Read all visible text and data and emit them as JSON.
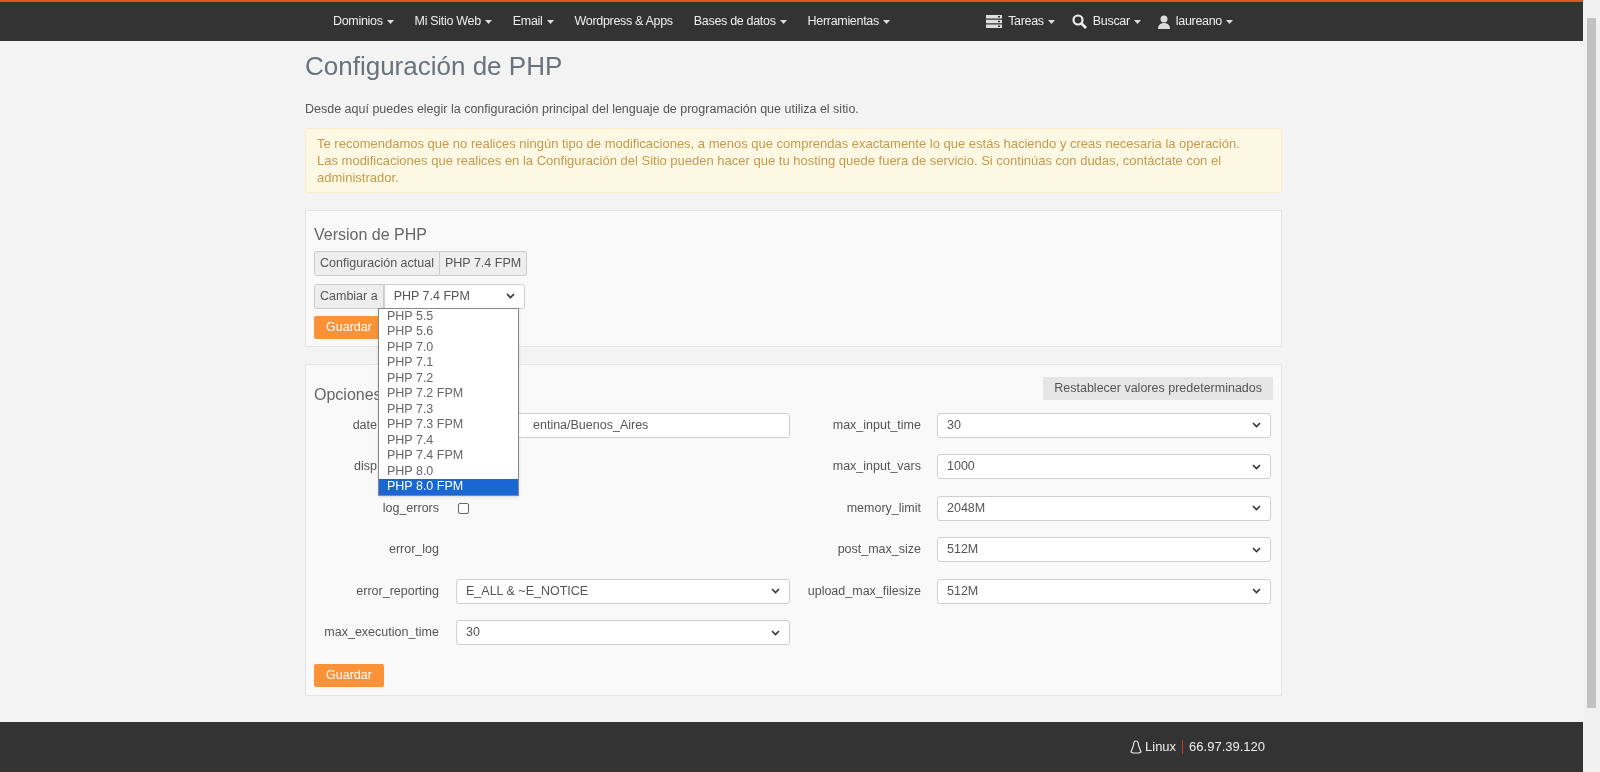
{
  "nav": {
    "items": [
      {
        "label": "Dominios",
        "dropdown": true
      },
      {
        "label": "Mi Sitio Web",
        "dropdown": true
      },
      {
        "label": "Email",
        "dropdown": true
      },
      {
        "label": "Wordpress & Apps",
        "dropdown": false
      },
      {
        "label": "Bases de datos",
        "dropdown": true
      },
      {
        "label": "Herramientas",
        "dropdown": true
      }
    ],
    "right": [
      {
        "kind": "tasks",
        "label": "Tareas"
      },
      {
        "kind": "search",
        "label": "Buscar"
      },
      {
        "kind": "user",
        "label": "laureano"
      }
    ]
  },
  "title": "Configuración de PHP",
  "description": "Desde aquí puedes elegir la configuración principal del lenguaje de programación que utiliza el sitio.",
  "warning": [
    "Te recomendamos que no realices ningún tipo de modificaciones, a menos que comprendas exactamente lo que estás haciendo y creas necesaria la operación.",
    "Las modificaciones que realices en la Configuración del Sitio pueden hacer que tu hosting quede fuera de servicio. Si continúas con dudas, contáctate con el administrador."
  ],
  "version": {
    "title": "Version de PHP",
    "current_label": "Configuración actual",
    "current_value": "PHP 7.4 FPM",
    "change_label": "Cambiar a",
    "select_value": "PHP 7.4 FPM",
    "save_button": "Guardar",
    "dropdown": [
      {
        "label": "PHP 5.5",
        "selected": false
      },
      {
        "label": "PHP 5.6",
        "selected": false
      },
      {
        "label": "PHP 7.0",
        "selected": false
      },
      {
        "label": "PHP 7.1",
        "selected": false
      },
      {
        "label": "PHP 7.2",
        "selected": false
      },
      {
        "label": "PHP 7.2 FPM",
        "selected": false
      },
      {
        "label": "PHP 7.3",
        "selected": false
      },
      {
        "label": "PHP 7.3 FPM",
        "selected": false
      },
      {
        "label": "PHP 7.4",
        "selected": false
      },
      {
        "label": "PHP 7.4 FPM",
        "selected": false
      },
      {
        "label": "PHP 8.0",
        "selected": false
      },
      {
        "label": "PHP 8.0 FPM",
        "selected": true
      }
    ]
  },
  "options": {
    "title": "Opciones",
    "reset_button": "Restablecer valores predeterminados",
    "save_button": "Guardar",
    "left": [
      {
        "label": "date",
        "kind": "text",
        "value": "entina/Buenos_Aires",
        "covered": true
      },
      {
        "label": "disp",
        "kind": "none",
        "covered": true
      },
      {
        "label": "log_errors",
        "kind": "checkbox",
        "checked": false
      },
      {
        "label": "error_log",
        "kind": "none"
      },
      {
        "label": "error_reporting",
        "kind": "select",
        "value": "E_ALL & ~E_NOTICE"
      },
      {
        "label": "max_execution_time",
        "kind": "select",
        "value": "30"
      }
    ],
    "right": [
      {
        "label": "max_input_time",
        "kind": "select",
        "value": "30"
      },
      {
        "label": "max_input_vars",
        "kind": "select",
        "value": "1000"
      },
      {
        "label": "memory_limit",
        "kind": "select",
        "value": "2048M"
      },
      {
        "label": "post_max_size",
        "kind": "select",
        "value": "512M"
      },
      {
        "label": "upload_max_filesize",
        "kind": "select",
        "value": "512M"
      }
    ]
  },
  "footer": {
    "os": "Linux",
    "ip": "66.97.39.120"
  }
}
